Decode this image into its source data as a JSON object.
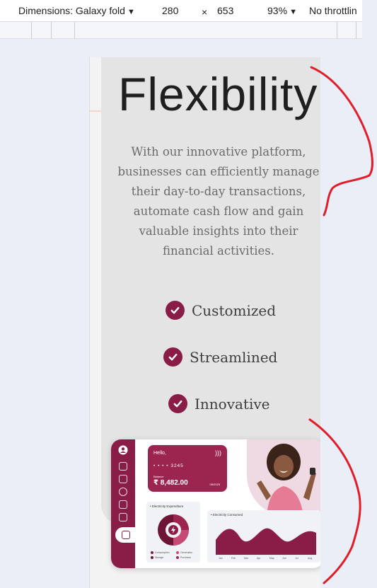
{
  "devtools": {
    "dimensions_label": "Dimensions: Galaxy fold",
    "width": "280",
    "times": "×",
    "height": "653",
    "zoom": "93%",
    "throttling": "No throttlin"
  },
  "hero": {
    "title": "Flexibility",
    "description": "With our innovative platform, businesses can efficiently manage their day-to-day transactions, automate cash flow and gain valuable insights into their financial activities."
  },
  "features": [
    {
      "label": "Customized",
      "icon": "check-circle-icon"
    },
    {
      "label": "Streamlined",
      "icon": "check-circle-icon"
    },
    {
      "label": "Innovative",
      "icon": "check-circle-icon"
    }
  ],
  "dashboard": {
    "greeting": "Hello,",
    "card_number": "• • • •  3245",
    "balance_label": "Balance",
    "balance": "₹ 8,482.00",
    "expiry": "08/2025",
    "expenditure_title": "• Electricity Expenditure",
    "consumed_title": "• Electricity Consumed",
    "legend": [
      "Consumption",
      "Generation",
      "Storage",
      "Purchase"
    ],
    "months": [
      "Jan",
      "Feb",
      "Mar",
      "Apr",
      "May",
      "Jun",
      "Jul",
      "Aug"
    ]
  },
  "colors": {
    "brand": "#8a1d47",
    "annotation": "#e11d2a"
  }
}
